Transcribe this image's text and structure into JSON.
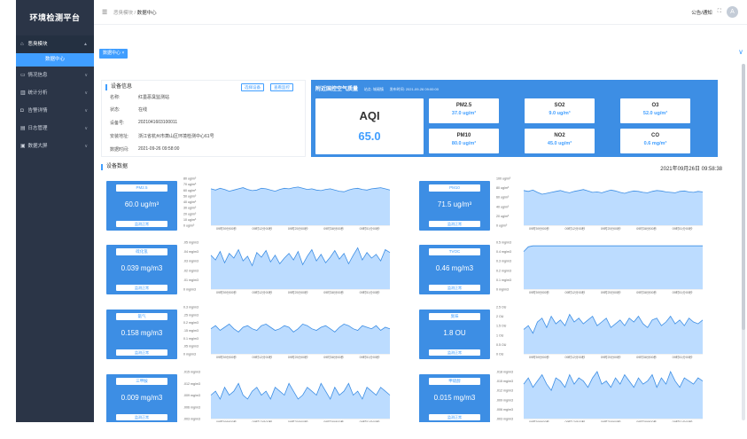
{
  "app": {
    "title": "环境检测平台"
  },
  "sidebar": {
    "items": [
      {
        "label": "恶臭模块",
        "icon": "home-icon",
        "open": true,
        "chev": "▲"
      },
      {
        "label": "数据中心",
        "sub": true
      },
      {
        "label": "情况信息",
        "icon": "monitor-icon",
        "chev": "∨"
      },
      {
        "label": "统计分析",
        "icon": "bar-chart-icon",
        "chev": "∨"
      },
      {
        "label": "告警详情",
        "icon": "bell-icon",
        "chev": "∨"
      },
      {
        "label": "日志管理",
        "icon": "document-icon",
        "chev": "∨"
      },
      {
        "label": "数据大屏",
        "icon": "screen-icon",
        "chev": "∨"
      }
    ]
  },
  "topbar": {
    "breadcrumb": [
      "恶臭模块",
      "数据中心"
    ],
    "separator": "/",
    "notice": "公告/通知",
    "avatar": "A"
  },
  "tabs": [
    {
      "label": "数据中心",
      "close": "×"
    }
  ],
  "device_info": {
    "title": "设备信息",
    "buttons": {
      "select": "选择设备",
      "monitor": "查看监控"
    },
    "rows": [
      {
        "k": "名称:",
        "v": "红墨恶臭监测站"
      },
      {
        "k": "状态:",
        "v": "在线"
      },
      {
        "k": "设备号:",
        "v": "2021041603100011"
      },
      {
        "k": "安装地址:",
        "v": "浙江省杭州市萧山区环境检测中心61号"
      },
      {
        "k": "数据时间:",
        "v": "2021-09-26 09:58:00"
      }
    ]
  },
  "air_quality": {
    "title": "附近国控空气质量",
    "station": "站点: 城厢镇",
    "publish_time": "发布时间: 2021-09-26 09:00:00",
    "aqi_label": "AQI",
    "aqi_value": "65.0",
    "pollutants": [
      {
        "name": "PM2.5",
        "value": "37.0 ug/m³"
      },
      {
        "name": "SO2",
        "value": "9.0 ug/m³"
      },
      {
        "name": "O3",
        "value": "52.0 ug/m³"
      },
      {
        "name": "PM10",
        "value": "80.0 ug/m³"
      },
      {
        "name": "NO2",
        "value": "45.0 ug/m³"
      },
      {
        "name": "CO",
        "value": "0.6 mg/m³"
      }
    ]
  },
  "device_data": {
    "title": "设备数据",
    "timestamp": "2021年09月26日 09:58:38",
    "x_ticks": [
      "09时59分00秒",
      "09时12分00秒",
      "09时25分00秒",
      "09时38分00秒",
      "09时51分00秒"
    ],
    "metrics": [
      {
        "name": "PM2.5",
        "value": "60.0 ug/m³",
        "status": "监测正常",
        "y_ticks": [
          "80 ug/m³",
          "70 ug/m³",
          "60 ug/m³",
          "50 ug/m³",
          "40 ug/m³",
          "30 ug/m³",
          "20 ug/m³",
          "10 ug/m³",
          "0 ug/m³"
        ],
        "series": [
          62,
          60,
          63,
          61,
          58,
          60,
          62,
          64,
          61,
          59,
          60,
          63,
          62,
          60,
          58,
          61,
          63,
          62,
          64,
          65,
          63,
          61,
          62,
          60,
          59,
          61,
          62,
          60,
          58,
          57,
          60,
          62,
          63,
          61,
          60,
          62,
          63,
          64,
          62,
          60
        ]
      },
      {
        "name": "PM10",
        "value": "71.5 ug/m³",
        "status": "监测正常",
        "y_ticks": [
          "100 ug/m³",
          "80 ug/m³",
          "60 ug/m³",
          "40 ug/m³",
          "20 ug/m³",
          "0 ug/m³"
        ],
        "series": [
          74,
          72,
          75,
          70,
          66,
          68,
          70,
          72,
          74,
          71,
          69,
          72,
          74,
          76,
          73,
          70,
          71,
          69,
          72,
          75,
          73,
          70,
          68,
          71,
          73,
          72,
          70,
          69,
          72,
          74,
          73,
          71,
          70,
          69,
          72,
          73,
          71,
          70,
          72,
          71
        ]
      },
      {
        "name": "硫化氢",
        "value": "0.039 mg/m3",
        "status": "监测正常",
        "y_ticks": [
          ".05 mg/m3",
          ".04 mg/m3",
          ".03 mg/m3",
          ".02 mg/m3",
          ".01 mg/m3",
          "0 mg/m3"
        ],
        "series": [
          0.036,
          0.031,
          0.04,
          0.028,
          0.038,
          0.033,
          0.042,
          0.03,
          0.035,
          0.025,
          0.039,
          0.034,
          0.041,
          0.029,
          0.036,
          0.027,
          0.033,
          0.038,
          0.031,
          0.04,
          0.026,
          0.035,
          0.042,
          0.03,
          0.037,
          0.028,
          0.034,
          0.041,
          0.032,
          0.038,
          0.027,
          0.036,
          0.044,
          0.031,
          0.039,
          0.033,
          0.037,
          0.03,
          0.042,
          0.039
        ]
      },
      {
        "name": "TVOC",
        "value": "0.46 mg/m3",
        "status": "监测正常",
        "y_ticks": [
          "0.5 mg/m3",
          "0.4 mg/m3",
          "0.3 mg/m3",
          "0.2 mg/m3",
          "0.1 mg/m3",
          "0 mg/m3"
        ],
        "series": [
          0.4,
          0.45,
          0.46,
          0.46,
          0.46,
          0.46,
          0.46,
          0.46,
          0.46,
          0.46,
          0.46,
          0.46,
          0.46,
          0.46,
          0.46,
          0.46,
          0.46,
          0.46,
          0.46,
          0.46,
          0.46,
          0.46,
          0.46,
          0.46,
          0.46,
          0.46,
          0.46,
          0.46,
          0.46,
          0.46,
          0.46,
          0.46,
          0.46,
          0.46,
          0.46,
          0.46,
          0.46,
          0.46,
          0.46,
          0.46
        ]
      },
      {
        "name": "氨气",
        "value": "0.158 mg/m3",
        "status": "监测正常",
        "y_ticks": [
          "0.3 mg/m3",
          ".25 mg/m3",
          "0.2 mg/m3",
          ".15 mg/m3",
          "0.1 mg/m3",
          ".05 mg/m3",
          "0 mg/m3"
        ],
        "series": [
          0.16,
          0.18,
          0.15,
          0.17,
          0.19,
          0.16,
          0.14,
          0.17,
          0.18,
          0.16,
          0.15,
          0.18,
          0.19,
          0.17,
          0.15,
          0.16,
          0.18,
          0.17,
          0.14,
          0.16,
          0.19,
          0.18,
          0.16,
          0.15,
          0.17,
          0.18,
          0.16,
          0.14,
          0.17,
          0.19,
          0.18,
          0.16,
          0.15,
          0.18,
          0.17,
          0.16,
          0.18,
          0.15,
          0.17,
          0.16
        ]
      },
      {
        "name": "臭味",
        "value": "1.8 OU",
        "status": "监测正常",
        "y_ticks": [
          "2.5 OU",
          "2 OU",
          "1.5 OU",
          "1 OU",
          "0.5 OU",
          "0 OU"
        ],
        "series": [
          1.3,
          1.5,
          1.1,
          1.7,
          1.9,
          1.4,
          2.0,
          1.6,
          1.8,
          1.5,
          2.1,
          1.7,
          1.9,
          1.6,
          1.8,
          2.0,
          1.5,
          1.7,
          1.9,
          1.4,
          1.6,
          1.8,
          1.5,
          1.9,
          1.7,
          2.0,
          1.6,
          1.4,
          1.8,
          1.9,
          1.5,
          1.7,
          2.0,
          1.6,
          1.8,
          1.5,
          1.9,
          1.7,
          1.6,
          1.8
        ]
      },
      {
        "name": "三甲胺",
        "value": "0.009 mg/m3",
        "status": "监测正常",
        "y_ticks": [
          ".015 mg/m3",
          ".012 mg/m3",
          ".009 mg/m3",
          ".006 mg/m3",
          ".003 mg/m3"
        ],
        "series": [
          0.009,
          0.01,
          0.008,
          0.011,
          0.009,
          0.01,
          0.012,
          0.009,
          0.008,
          0.01,
          0.011,
          0.009,
          0.01,
          0.008,
          0.011,
          0.01,
          0.009,
          0.012,
          0.01,
          0.008,
          0.009,
          0.011,
          0.01,
          0.009,
          0.012,
          0.01,
          0.008,
          0.011,
          0.009,
          0.01,
          0.012,
          0.009,
          0.01,
          0.008,
          0.011,
          0.01,
          0.009,
          0.011,
          0.01,
          0.009
        ]
      },
      {
        "name": "甲硫醇",
        "value": "0.015 mg/m3",
        "status": "监测正常",
        "y_ticks": [
          ".018 mg/m3",
          ".015 mg/m3",
          ".012 mg/m3",
          ".009 mg/m3",
          ".006 mg/m3",
          ".003 mg/m3"
        ],
        "series": [
          0.014,
          0.016,
          0.013,
          0.015,
          0.017,
          0.014,
          0.012,
          0.016,
          0.015,
          0.013,
          0.017,
          0.014,
          0.016,
          0.015,
          0.013,
          0.016,
          0.018,
          0.014,
          0.015,
          0.013,
          0.016,
          0.014,
          0.017,
          0.015,
          0.013,
          0.016,
          0.014,
          0.015,
          0.017,
          0.013,
          0.016,
          0.014,
          0.018,
          0.015,
          0.013,
          0.016,
          0.015,
          0.014,
          0.016,
          0.015
        ]
      }
    ]
  },
  "colors": {
    "accent": "#409eff",
    "sidebar": "#2b3547",
    "card": "#3d8ee4",
    "area": "#bcdcff"
  }
}
